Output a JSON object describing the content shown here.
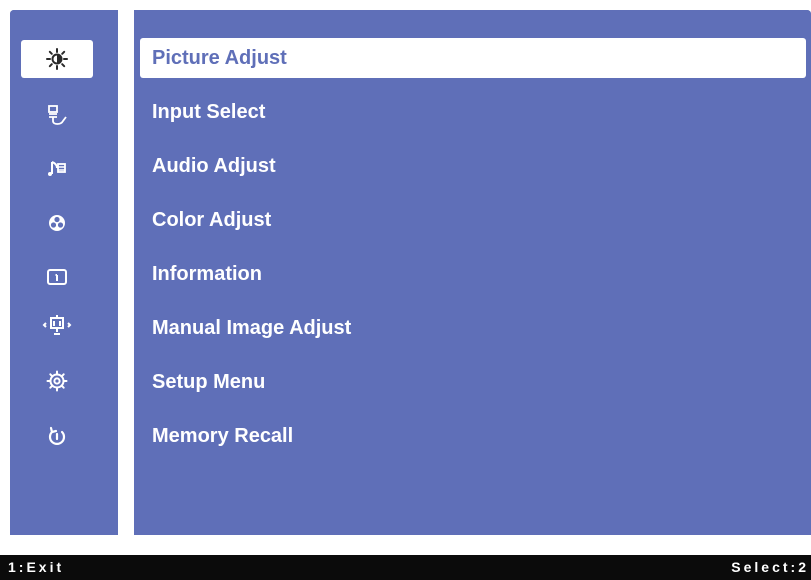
{
  "menu": {
    "items": [
      {
        "label": "Picture Adjust",
        "icon": "brightness-icon",
        "selected": true
      },
      {
        "label": "Input Select",
        "icon": "input-select-icon",
        "selected": false
      },
      {
        "label": "Audio Adjust",
        "icon": "audio-icon",
        "selected": false
      },
      {
        "label": "Color Adjust",
        "icon": "color-icon",
        "selected": false
      },
      {
        "label": "Information",
        "icon": "information-icon",
        "selected": false
      },
      {
        "label": "Manual Image Adjust",
        "icon": "image-adjust-icon",
        "selected": false
      },
      {
        "label": "Setup Menu",
        "icon": "setup-icon",
        "selected": false
      },
      {
        "label": "Memory Recall",
        "icon": "recall-icon",
        "selected": false
      }
    ]
  },
  "footer": {
    "exit_label": "1:Exit",
    "select_label": "Select:2"
  },
  "colors": {
    "background": "#5f6fb8",
    "highlight": "#ffffff",
    "footer": "#0b0b0b"
  }
}
